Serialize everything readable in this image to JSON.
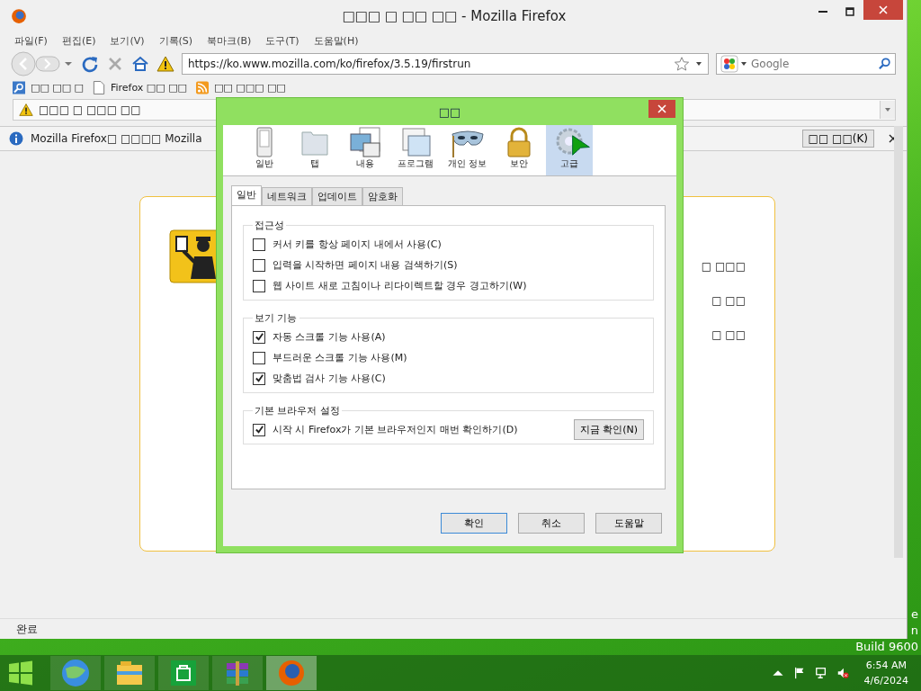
{
  "window": {
    "title": "□□□ □ □□ □□ - Mozilla Firefox"
  },
  "menu": [
    "파일(F)",
    "편집(E)",
    "보기(V)",
    "기록(S)",
    "북마크(B)",
    "도구(T)",
    "도움말(H)"
  ],
  "nav": {
    "url": "https://ko.www.mozilla.com/ko/firefox/3.5.19/firstrun",
    "search_placeholder": "Google"
  },
  "bookmarks": [
    {
      "kind": "search",
      "label": "□□ □□ □"
    },
    {
      "kind": "page",
      "label": "Firefox □□ □□"
    },
    {
      "kind": "feed",
      "label": "□□ □□□ □□"
    }
  ],
  "notice": {
    "label": "□□□ □ □□□ □□"
  },
  "infobar": {
    "text": "Mozilla Firefox□ □□□□ Mozilla",
    "button": "□□ □□(K)"
  },
  "page": {
    "lines": [
      "□ □□□",
      "□ □□",
      "□ □□"
    ]
  },
  "status_bar": "완료",
  "dialog": {
    "title": "□□",
    "panes": [
      {
        "kind": "general",
        "label": "일반",
        "selected": false
      },
      {
        "kind": "tabs",
        "label": "탭",
        "selected": false
      },
      {
        "kind": "content",
        "label": "내용",
        "selected": false
      },
      {
        "kind": "applications",
        "label": "프로그램",
        "selected": false
      },
      {
        "kind": "privacy",
        "label": "개인 정보",
        "selected": false
      },
      {
        "kind": "security",
        "label": "보안",
        "selected": false
      },
      {
        "kind": "advanced",
        "label": "고급",
        "selected": true
      }
    ],
    "tabs": [
      {
        "label": "일반",
        "selected": true
      },
      {
        "label": "네트워크",
        "selected": false
      },
      {
        "label": "업데이트",
        "selected": false
      },
      {
        "label": "암호화",
        "selected": false
      }
    ],
    "groups": [
      {
        "title": "접근성",
        "options": [
          {
            "label": "커서 키를 항상 페이지 내에서 사용(C)",
            "checked": false
          },
          {
            "label": "입력을 시작하면 페이지 내용 검색하기(S)",
            "checked": false
          },
          {
            "label": "웹 사이트 새로 고침이나 리다이렉트할 경우 경고하기(W)",
            "checked": false
          }
        ]
      },
      {
        "title": "보기 기능",
        "options": [
          {
            "label": "자동 스크롤 기능 사용(A)",
            "checked": true
          },
          {
            "label": "부드러운 스크롤 기능 사용(M)",
            "checked": false
          },
          {
            "label": "맞춤법 검사 기능 사용(C)",
            "checked": true
          }
        ]
      },
      {
        "title": "기본 브라우저 설정",
        "options": [
          {
            "label": "시작 시 Firefox가 기본 브라우저인지 매번 확인하기(D)",
            "checked": true
          }
        ],
        "button": "지금 확인(N)"
      }
    ],
    "buttons": [
      {
        "label": "확인",
        "default": true
      },
      {
        "label": "취소",
        "default": false
      },
      {
        "label": "도움말",
        "default": false
      }
    ]
  },
  "desktop": {
    "watermark": [
      "e",
      "n",
      "Build 9600"
    ]
  },
  "taskbar": {
    "apps": [
      {
        "kind": "ie",
        "active": false
      },
      {
        "kind": "explorer",
        "active": false
      },
      {
        "kind": "store",
        "active": false
      },
      {
        "kind": "archiver",
        "active": false
      },
      {
        "kind": "firefox",
        "active": true
      }
    ],
    "time": "6:54 AM",
    "date": "4/6/2024"
  }
}
